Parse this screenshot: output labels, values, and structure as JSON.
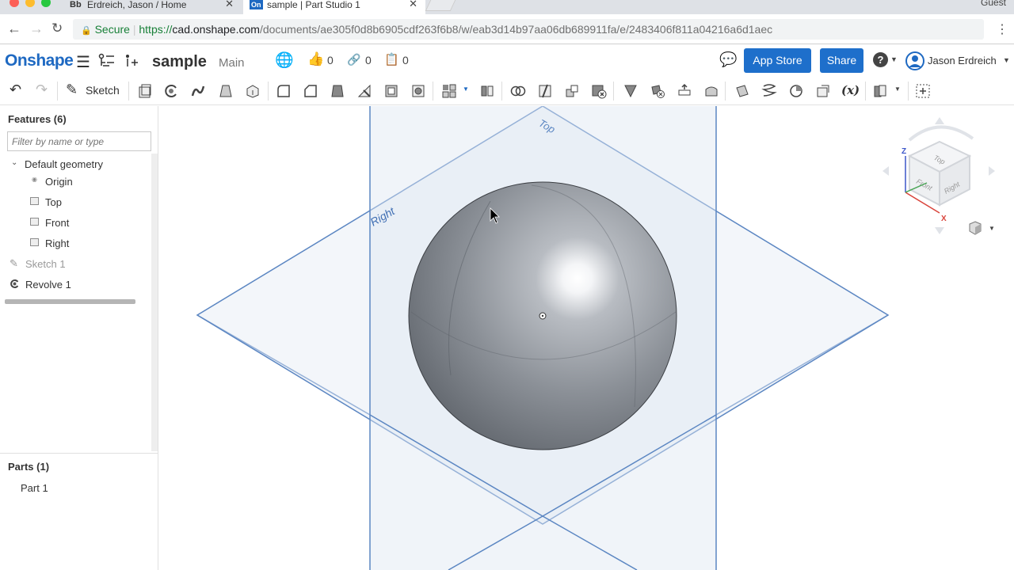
{
  "browser": {
    "tabs": [
      {
        "favicon": "Bb",
        "title": "Erdreich, Jason / Home"
      },
      {
        "favicon": "On",
        "title": "sample | Part Studio 1"
      }
    ],
    "profile": "Guest",
    "url": {
      "secure_label": "Secure",
      "scheme": "https://",
      "host": "cad.onshape.com",
      "path": "/documents/ae305f0d8b6905cdf263f6b8/w/eab3d14b97aa06db689911fa/e/2483406f811a04216a6d1aec"
    }
  },
  "app": {
    "logo": "Onshape",
    "document_name": "sample",
    "branch": "Main",
    "likes": "0",
    "links": "0",
    "copies": "0",
    "app_store_label": "App Store",
    "share_label": "Share",
    "user_name": "Jason Erdreich"
  },
  "toolbar": {
    "sketch_label": "Sketch",
    "variable_label": "(x)"
  },
  "features": {
    "header": "Features (6)",
    "filter_placeholder": "Filter by name or type",
    "default_geometry": "Default geometry",
    "origin": "Origin",
    "top": "Top",
    "front": "Front",
    "right": "Right",
    "sketch1": "Sketch 1",
    "revolve1": "Revolve 1"
  },
  "parts": {
    "header": "Parts (1)",
    "part1": "Part 1"
  },
  "viewport": {
    "plane_top_label": "Top",
    "plane_right_label": "Right",
    "viewcube": {
      "top": "Top",
      "front": "Front",
      "right": "Right",
      "axis_z": "Z",
      "axis_x": "X"
    }
  },
  "colors": {
    "brand": "#1e69c2",
    "button_blue": "#1e6fcb",
    "plane_edge": "#5b86c2",
    "plane_fill": "#dde6f2",
    "sphere": "#8d9198"
  }
}
